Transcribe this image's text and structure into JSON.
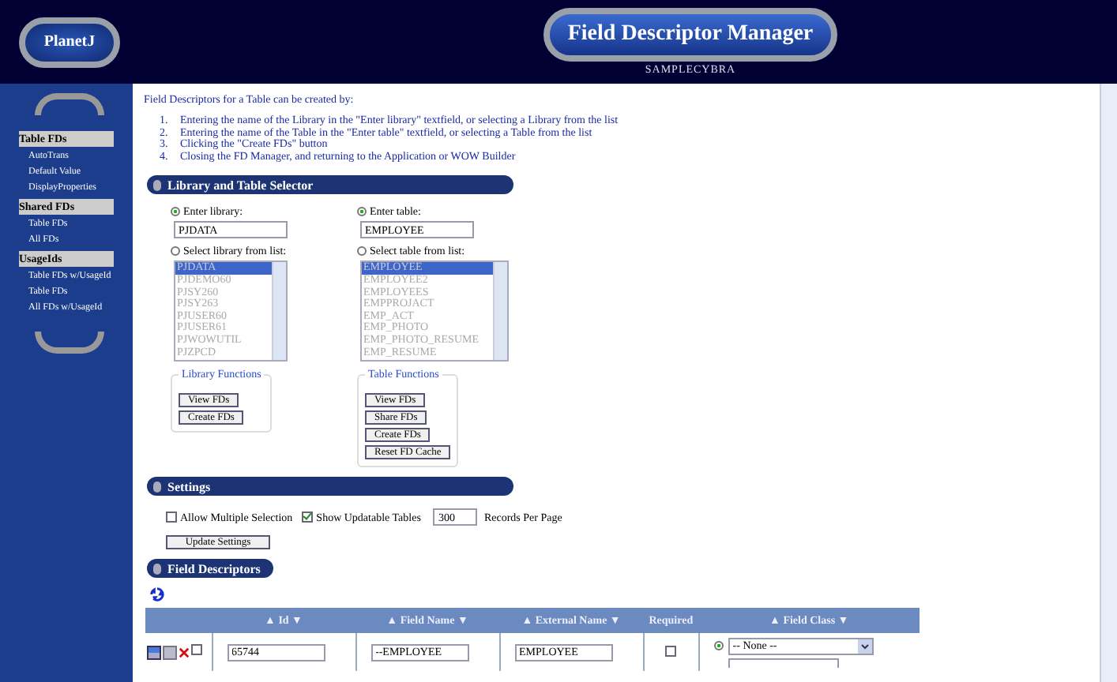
{
  "header": {
    "logo": "PlanetJ",
    "title": "Field Descriptor Manager",
    "subtitle": "SAMPLECYBRA"
  },
  "sidebar": {
    "sections": [
      {
        "title": "Table FDs",
        "items": [
          "AutoTrans",
          "Default Value",
          "DisplayProperties"
        ]
      },
      {
        "title": "Shared FDs",
        "items": [
          "Table FDs",
          "All FDs"
        ]
      },
      {
        "title": "UsageIds",
        "items": [
          "Table FDs w/UsageId",
          "Table FDs",
          "All FDs w/UsageId"
        ]
      }
    ]
  },
  "intro": "Field Descriptors for a Table can be created by:",
  "steps": [
    {
      "number": "1.",
      "text": "Entering the name of the Library in the \"Enter library\" textfield, or selecting a Library from the list"
    },
    {
      "number": "2.",
      "text": "Entering the name of the Table in the \"Enter table\" textfield, or selecting a Table from the list"
    },
    {
      "number": "3.",
      "text": "Clicking the \"Create FDs\" button"
    },
    {
      "number": "4.",
      "text": "Closing the FD Manager, and returning to the Application or WOW Builder"
    }
  ],
  "selector": {
    "title": "Library and Table Selector",
    "columns": [
      {
        "enter_label": "Enter library:",
        "enter_selected": true,
        "value": "PJDATA",
        "list_label": "Select library from list:",
        "list_selected": false,
        "list_disabled": true,
        "items": [
          {
            "label": "PJDATA",
            "selected": true
          },
          {
            "label": "PJDEMO60",
            "selected": false
          },
          {
            "label": "PJSY260",
            "selected": false
          },
          {
            "label": "PJSY263",
            "selected": false
          },
          {
            "label": "PJUSER60",
            "selected": false
          },
          {
            "label": "PJUSER61",
            "selected": false
          },
          {
            "label": "PJWOWUTIL",
            "selected": false
          },
          {
            "label": "PJZPCD",
            "selected": false
          }
        ],
        "functions_title": "Library Functions",
        "buttons": [
          "View FDs",
          "Create FDs"
        ]
      },
      {
        "enter_label": "Enter table:",
        "enter_selected": true,
        "value": "EMPLOYEE",
        "list_label": "Select table from list:",
        "list_selected": false,
        "list_disabled": true,
        "items": [
          {
            "label": "EMPLOYEE",
            "selected": true
          },
          {
            "label": "EMPLOYEE2",
            "selected": false
          },
          {
            "label": "EMPLOYEES",
            "selected": false
          },
          {
            "label": "EMPPROJACT",
            "selected": false
          },
          {
            "label": "EMP_ACT",
            "selected": false
          },
          {
            "label": "EMP_PHOTO",
            "selected": false
          },
          {
            "label": "EMP_PHOTO_RESUME",
            "selected": false
          },
          {
            "label": "EMP_RESUME",
            "selected": false
          }
        ],
        "functions_title": "Table Functions",
        "buttons": [
          "View FDs",
          "Share FDs",
          "Create FDs",
          "Reset FD Cache"
        ]
      }
    ]
  },
  "settings": {
    "title": "Settings",
    "options": [
      {
        "label": "Allow Multiple Selection",
        "checked": false
      },
      {
        "label": "Show Updatable Tables",
        "checked": true
      }
    ],
    "records_value": "300",
    "records_label": "Records Per Page",
    "button": "Update Settings"
  },
  "field_descriptors": {
    "title": "Field Descriptors",
    "columns": [
      {
        "label": "Id",
        "sortable": true
      },
      {
        "label": "Field Name",
        "sortable": true
      },
      {
        "label": "External Name",
        "sortable": true
      },
      {
        "label": "Required",
        "sortable": false
      },
      {
        "label": "Field Class",
        "sortable": true
      }
    ],
    "sort_up": "▲",
    "sort_down": "▼",
    "rows": [
      {
        "checked": false,
        "id": "65744",
        "field_name": "--EMPLOYEE",
        "external_name": "EMPLOYEE",
        "required": false,
        "class_selected": true,
        "field_class": "-- None --"
      }
    ]
  }
}
